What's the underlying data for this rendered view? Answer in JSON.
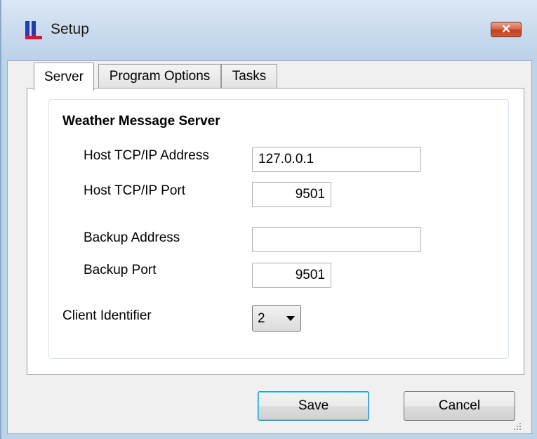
{
  "window": {
    "title": "Setup",
    "close_glyph": "✕",
    "app_icon": "app-logo-icon",
    "accent_color": "#c2401f"
  },
  "tabs": [
    {
      "label": "Server",
      "active": true
    },
    {
      "label": "Program Options",
      "active": false
    },
    {
      "label": "Tasks",
      "active": false
    }
  ],
  "server": {
    "group_title": "Weather Message Server",
    "host_address_label": "Host TCP/IP Address",
    "host_address_value": "127.0.0.1",
    "host_port_label": "Host TCP/IP Port",
    "host_port_value": "9501",
    "backup_address_label": "Backup Address",
    "backup_address_value": "",
    "backup_port_label": "Backup Port",
    "backup_port_value": "9501",
    "client_id_label": "Client Identifier",
    "client_id_value": "2"
  },
  "buttons": {
    "save_label": "Save",
    "cancel_label": "Cancel"
  }
}
